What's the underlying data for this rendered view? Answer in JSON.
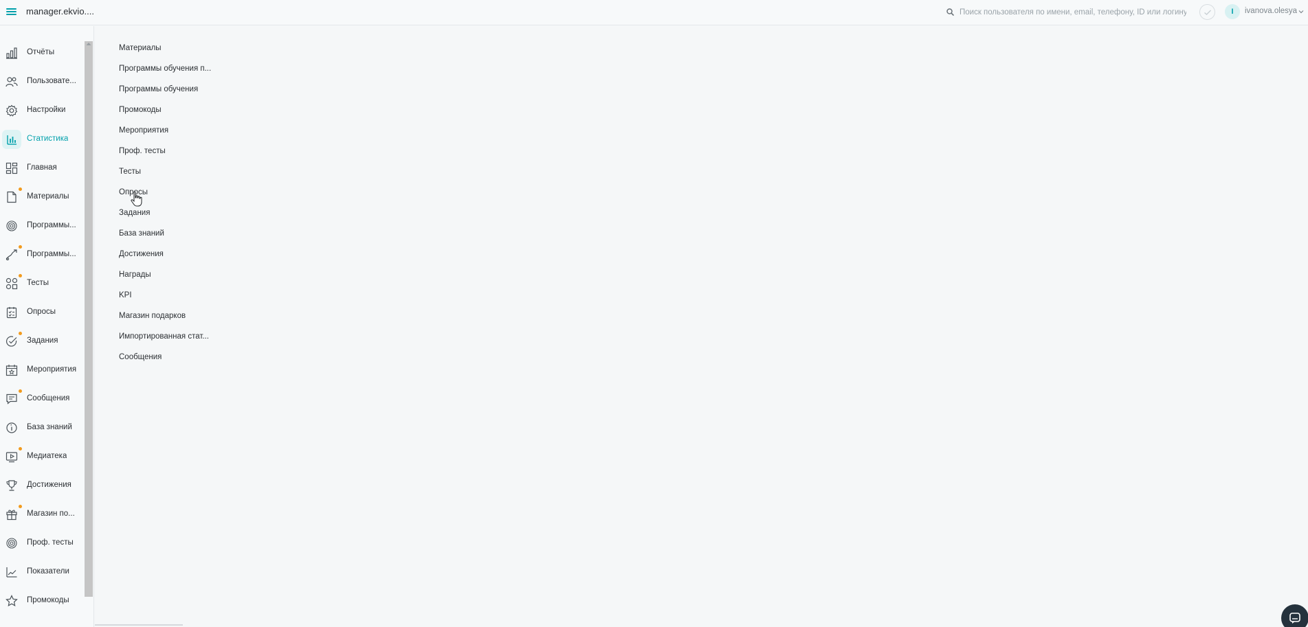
{
  "header": {
    "app_title": "manager.ekvio....",
    "search_placeholder": "Поиск пользователя по имени, email, телефону, ID или логину",
    "avatar_letter": "I",
    "username": "ivanova.olesya"
  },
  "sidebar": {
    "items": [
      {
        "label": "Отчёты",
        "icon": "chart-bars-icon",
        "dot": false,
        "active": false
      },
      {
        "label": "Пользовате...",
        "icon": "users-icon",
        "dot": false,
        "active": false
      },
      {
        "label": "Настройки",
        "icon": "gear-icon",
        "dot": false,
        "active": false
      },
      {
        "label": "Статистика",
        "icon": "stats-icon",
        "dot": false,
        "active": true
      },
      {
        "label": "Главная",
        "icon": "dashboard-icon",
        "dot": false,
        "active": false
      },
      {
        "label": "Материалы",
        "icon": "document-icon",
        "dot": true,
        "active": false
      },
      {
        "label": "Программы...",
        "icon": "program-icon",
        "dot": false,
        "active": false
      },
      {
        "label": "Программы...",
        "icon": "route-icon",
        "dot": true,
        "active": false
      },
      {
        "label": "Тесты",
        "icon": "tests-icon",
        "dot": true,
        "active": false
      },
      {
        "label": "Опросы",
        "icon": "survey-icon",
        "dot": false,
        "active": false
      },
      {
        "label": "Задания",
        "icon": "task-check-icon",
        "dot": true,
        "active": false
      },
      {
        "label": "Мероприятия",
        "icon": "calendar-star-icon",
        "dot": false,
        "active": false
      },
      {
        "label": "Сообщения",
        "icon": "message-icon",
        "dot": true,
        "active": false
      },
      {
        "label": "База знаний",
        "icon": "info-circle-icon",
        "dot": false,
        "active": false
      },
      {
        "label": "Медиатека",
        "icon": "media-icon",
        "dot": true,
        "active": false
      },
      {
        "label": "Достижения",
        "icon": "trophy-icon",
        "dot": false,
        "active": false
      },
      {
        "label": "Магазин по...",
        "icon": "gift-icon",
        "dot": true,
        "active": false
      },
      {
        "label": "Проф. тесты",
        "icon": "target-icon",
        "dot": false,
        "active": false
      },
      {
        "label": "Показатели",
        "icon": "line-chart-icon",
        "dot": false,
        "active": false
      },
      {
        "label": "Промокоды",
        "icon": "star-icon",
        "dot": false,
        "active": false
      }
    ]
  },
  "main": {
    "items": [
      "Материалы",
      "Программы обучения п...",
      "Программы обучения",
      "Промокоды",
      "Мероприятия",
      "Проф. тесты",
      "Тесты",
      "Опросы",
      "Задания",
      "База знаний",
      "Достижения",
      "Награды",
      "KPI",
      "Магазин подарков",
      "Импортированная стат...",
      "Сообщения"
    ]
  },
  "colors": {
    "accent": "#00a0ab",
    "dot": "#f29b1e",
    "background": "#f5f7f8"
  }
}
